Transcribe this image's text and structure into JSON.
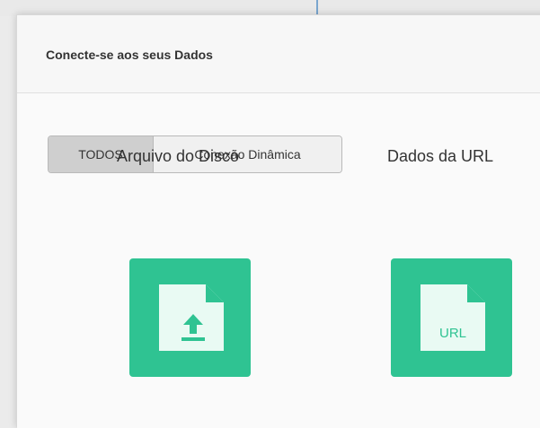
{
  "dialog": {
    "title": "Conecte-se aos seus Dados"
  },
  "tabs": [
    {
      "label": "TODOS",
      "selected": true
    },
    {
      "label": "Conexão Dinâmica",
      "selected": false
    }
  ],
  "sources": [
    {
      "label": "Arquivo do Disco",
      "icon": "file-upload-icon"
    },
    {
      "label": "Dados da URL",
      "icon": "file-url-icon",
      "badge": "URL"
    }
  ],
  "colors": {
    "tile": "#2fc392",
    "file_page": "#e9faf3",
    "icon_accent": "#2fc392"
  }
}
